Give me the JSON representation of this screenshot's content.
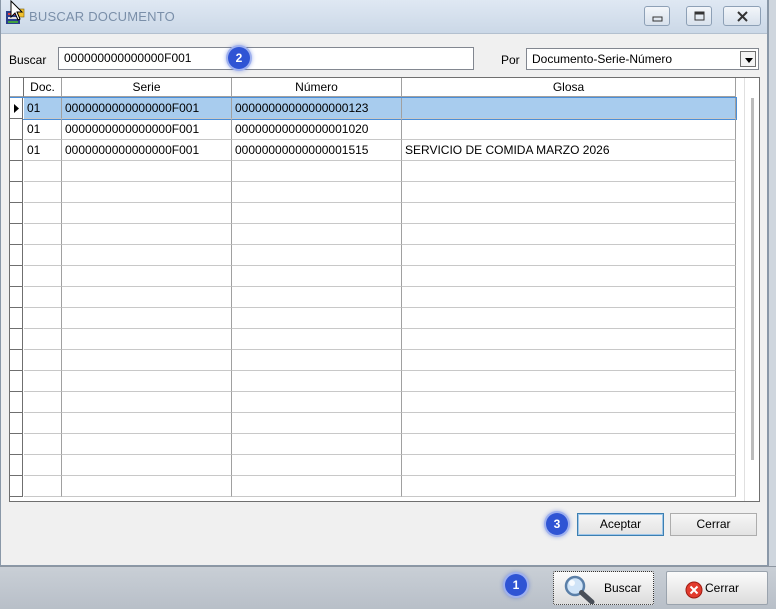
{
  "window": {
    "title": "BUSCAR DOCUMENTO"
  },
  "search": {
    "label": "Buscar",
    "value": "000000000000000F001",
    "by_label": "Por",
    "by_value": "Documento-Serie-Número"
  },
  "annotations": [
    "1",
    "2",
    "3"
  ],
  "grid": {
    "columns": [
      "Doc.",
      "Serie",
      "Número",
      "Glosa"
    ],
    "rows": [
      {
        "doc": "01",
        "serie": "0000000000000000F001",
        "numero": "00000000000000000123",
        "glosa": ""
      },
      {
        "doc": "01",
        "serie": "0000000000000000F001",
        "numero": "00000000000000001020",
        "glosa": ""
      },
      {
        "doc": "01",
        "serie": "0000000000000000F001",
        "numero": "00000000000000001515",
        "glosa": "SERVICIO DE COMIDA MARZO 2026"
      }
    ]
  },
  "dialog_buttons": {
    "accept": "Aceptar",
    "close": "Cerrar"
  },
  "bottom_buttons": {
    "search": "Buscar",
    "close": "Cerrar"
  },
  "colors": {
    "badge": "#2f54d4",
    "selected_row": "#a8ccee",
    "title_text": "#7a8fa9"
  },
  "icons": [
    "app-icon",
    "minimize-icon",
    "maximize-icon",
    "close-icon",
    "dropdown-arrow-icon",
    "magnifier-icon",
    "red-x-icon",
    "row-pointer-icon",
    "mouse-cursor-icon"
  ]
}
